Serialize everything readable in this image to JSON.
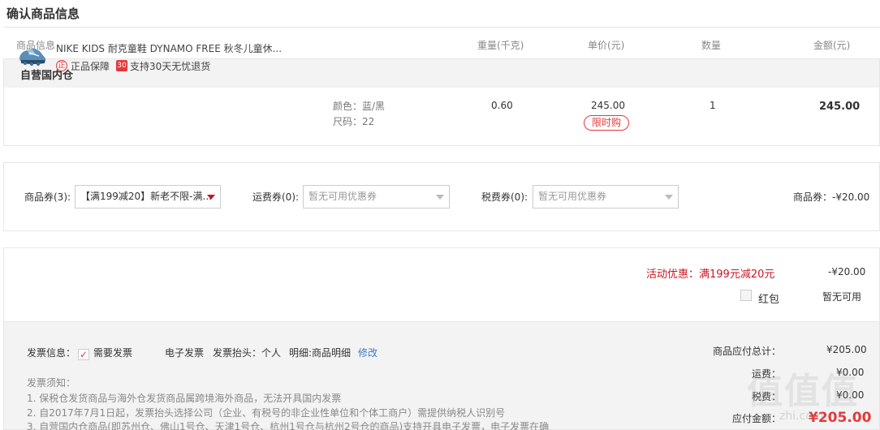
{
  "page_title": "确认商品信息",
  "table_headers": {
    "product_info": "商品信息",
    "weight": "重量(千克)",
    "unit_price": "单价(元)",
    "quantity": "数量",
    "amount": "金额(元)"
  },
  "warehouse": "自营国内仓",
  "product": {
    "name": "NIKE KIDS 耐克童鞋 DYNAMO FREE 秋冬儿童休...",
    "guarantee": "正品保障",
    "guarantee_icon": "正",
    "return_policy": "支持30天无忧退货",
    "return_icon": "30",
    "color": "颜色：蓝/黑",
    "size": "尺码：22",
    "weight": "0.60",
    "unit_price": "245.00",
    "flash_tag": "限时购",
    "quantity": "1",
    "amount": "245.00",
    "icon": "shoe-image"
  },
  "coupons": {
    "goods_label": "商品券(3):",
    "goods_selected": "【满199减20】新老不限-满...",
    "shipping_label": "运费券(0):",
    "shipping_placeholder": "暂无可用优惠券",
    "tax_label": "税费券(0):",
    "tax_placeholder": "暂无可用优惠券",
    "summary": "商品券：-¥20.00"
  },
  "promotion": {
    "label": "活动优惠：满199元减20元",
    "value": "-¥20.00",
    "red_packet_label": "红包",
    "red_packet_status": "暂无可用"
  },
  "invoice": {
    "label": "发票信息：",
    "need_invoice": "需要发票",
    "type": "电子发票",
    "title": "发票抬头：个人",
    "detail": "明细:商品明细",
    "edit": "修改",
    "notice_title": "发票须知：",
    "notice_1": "1. 保税仓发货商品与海外仓发货商品属跨境海外商品，无法开具国内发票",
    "notice_2": "2. 自2017年7月1日起，发票抬头选择公司（企业、有税号的非企业性单位和个体工商户）需提供纳税人识别号",
    "notice_3": "3. 自营国内仓商品(即苏州仓、佛山1号仓、天津1号仓、杭州1号仓与杭州2号仓的商品)支持开具电子发票，电子发票在确"
  },
  "totals": {
    "subtotal_label": "商品应付总计：",
    "subtotal": "¥205.00",
    "shipping_label": "运费：",
    "shipping": "¥0.00",
    "tax_label": "税费：",
    "tax": "¥0.00",
    "payable_label": "应付金额：",
    "payable": "¥205.00"
  },
  "watermark": {
    "main": "值值值",
    "sub": "zhi.com"
  },
  "colors": {
    "accent_red": "#e4393c",
    "promo_red": "#c81623",
    "link_blue": "#3b7ac6"
  }
}
